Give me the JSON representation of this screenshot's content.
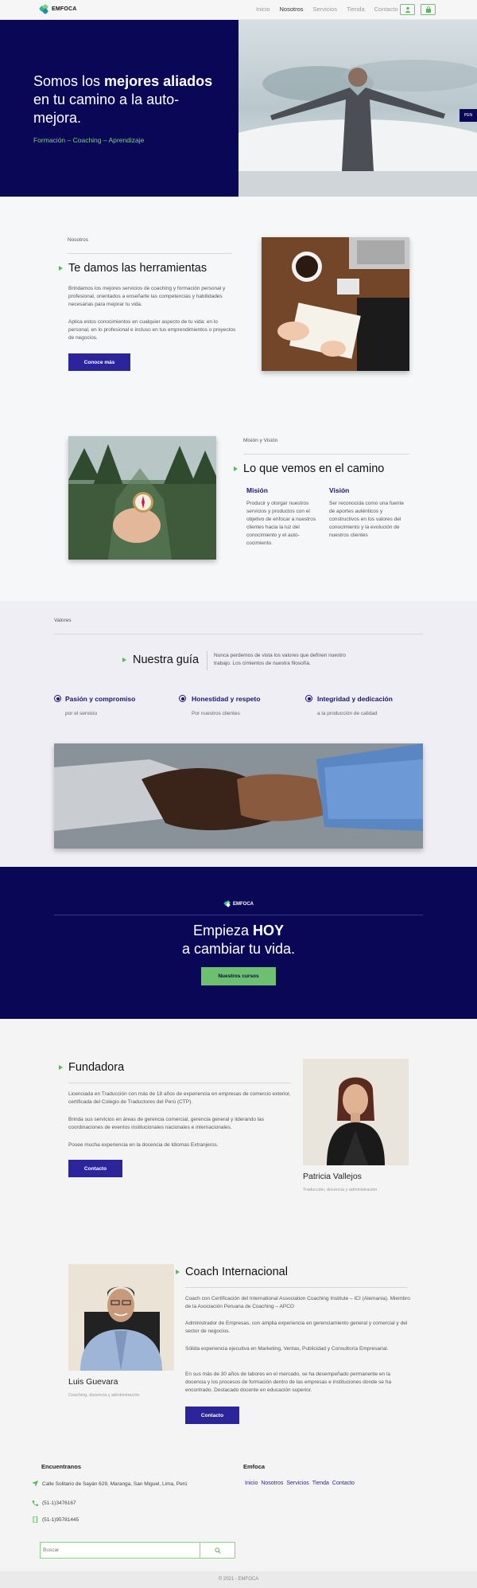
{
  "brand": {
    "name": "EMFOCA"
  },
  "nav": {
    "items": [
      "Inicio",
      "Nosotros",
      "Servicios",
      "Tienda",
      "Contacto"
    ],
    "active": "Nosotros"
  },
  "hero": {
    "title_part1": "Somos los ",
    "title_bold": "mejores aliados",
    "title_part2": " en tu camino a la auto-mejora.",
    "subtitle": "Formación – Coaching – Aprendizaje",
    "lang_label": "PEN"
  },
  "about": {
    "eyebrow": "Nosotros",
    "title": "Te damos las herramientas",
    "p1": "Brindamos los mejores servicios de coaching y formación personal y profesional, orientados a enseñarte las competencias y habilidades necesarias para mejorar tu vida.",
    "p2": "Aplica estos conocimientos en cualquier aspecto de tu vida: en lo personal, en lo profesional e incluso en tus emprendimientos o proyectos de negocios.",
    "button": "Conoce más"
  },
  "mission": {
    "eyebrow": "Misión y Visión",
    "title": "Lo que vemos en el camino",
    "mission_title": "Misión",
    "mission_text": "Producir y otorgar nuestros servicios y productos con el objetivo de enfocar a nuestros clientes hacia la luz del conocimiento y el auto-cocimiento.",
    "vision_title": "Visión",
    "vision_text": "Ser reconocida como una fuente de aportes auténticos y constructivos en los valores del conocimiento y la evolución de nuestros clientes"
  },
  "values": {
    "eyebrow": "Valores",
    "title": "Nuestra guía",
    "desc": "Nunca perdemos de vista los valores que definen nuestro trabajo. Los cimientos de nuestra filosofía.",
    "items": [
      {
        "title": "Pasión y compromiso",
        "sub": "por el servicio"
      },
      {
        "title": "Honestidad y respeto",
        "sub": "Por nuestros clientes"
      },
      {
        "title": "Integridad y dedicación",
        "sub": "a la producción de calidad"
      }
    ]
  },
  "cta": {
    "logo": "EMFOCA",
    "line1_part1": "Empieza ",
    "line1_bold": "HOY",
    "line2": "a cambiar tu vida.",
    "button": "Nuestros cursos"
  },
  "founder": {
    "title": "Fundadora",
    "p1": "Licenciada en Traducción con más de 18 años de experiencia en empresas de comercio exterior, certificada del Colegio de Traductores del Perú (CTP).",
    "p2": "Brinda sus servicios en áreas de gerencia comercial, gerencia general y liderando las coordinaciones de eventos institucionales nacionales e internacionales.",
    "p3": "Posee mucha experiencia en la docencia de Idiomas Extranjeros.",
    "button": "Contacto",
    "name": "Patricia Vallejos",
    "role": "Traducción, docencia y administración"
  },
  "coach": {
    "title": "Coach Internacional",
    "p1": "Coach con Certificación del International Association Coaching Institute – ICI (Alemania). Miembro de la Asociación Peruana de Coaching – APCO",
    "p2": "Administrador de Empresas, con amplia experiencia en gerenciamiento general y comercial y del sector de negocios.",
    "p3": "Sólida experiencia ejecutiva en Marketing, Ventas, Publicidad y Consultoría Empresarial.",
    "p4": "En sus más de 30 años de labores en el mercado, se ha desempeñado permanente en la docencia y los procesos de formación dentro de las empresas e instituciones donde se ha encontrado. Destacado docente en educación superior.",
    "button": "Contacto",
    "name": "Luis Guevara",
    "role": "Coaching, docencia y administración"
  },
  "footer": {
    "find_title": "Encuentranos",
    "address": "Calle Solitario de Sayán 629, Maranga, San Miguel, Lima, Perú",
    "phone1": "(51-1)3476167",
    "phone2": "(51-1)95781445",
    "links_title": "Emfoca",
    "links": [
      "Inicio",
      "Nosotros",
      "Servicios",
      "Tienda",
      "Contacto"
    ],
    "search_placeholder": "Buscar",
    "copyright": "© 2021 - EMFOCA"
  },
  "colors": {
    "navy": "#0b0757",
    "accent_green": "#6cc070",
    "button_blue": "#2c249a",
    "bg": "#f4f4f5"
  }
}
